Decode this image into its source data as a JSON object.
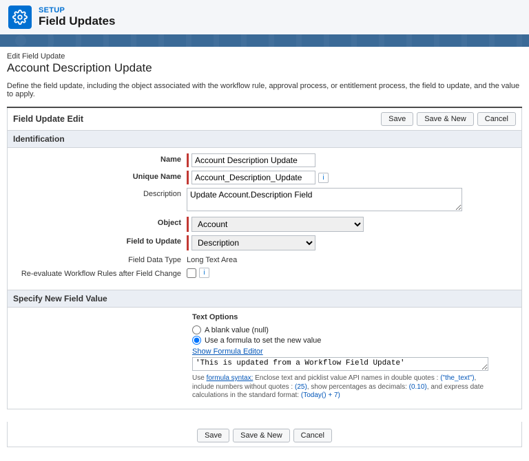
{
  "header": {
    "setup_label": "SETUP",
    "title": "Field Updates"
  },
  "page": {
    "edit_small": "Edit Field Update",
    "title": "Account Description Update",
    "intro": "Define the field update, including the object associated with the workflow rule, approval process, or entitlement process, the field to update, and the value to apply."
  },
  "panel": {
    "title": "Field Update Edit",
    "save": "Save",
    "save_new": "Save & New",
    "cancel": "Cancel"
  },
  "identification": {
    "section_title": "Identification",
    "name_label": "Name",
    "name_value": "Account Description Update",
    "unique_label": "Unique Name",
    "unique_value": "Account_Description_Update",
    "description_label": "Description",
    "description_value": "Update Account.Description Field",
    "object_label": "Object",
    "object_value": "Account",
    "field_label": "Field to Update",
    "field_value": "Description",
    "datatype_label": "Field Data Type",
    "datatype_value": "Long Text Area",
    "reeval_label": "Re-evaluate Workflow Rules after Field Change"
  },
  "newvalue": {
    "section_title": "Specify New Field Value",
    "text_options": "Text Options",
    "opt_blank": "A blank value (null)",
    "opt_formula": "Use a formula to set the new value",
    "show_editor": "Show Formula Editor",
    "formula_value": "'This is updated from a Workflow Field Update'",
    "hint_pre": "Use ",
    "hint_link": "formula syntax:",
    "hint_1": " Enclose text and picklist value API names in double quotes : ",
    "hint_ex1": "(\"the_text\")",
    "hint_2": ", include numbers without quotes : ",
    "hint_ex2": "(25)",
    "hint_3": ", show percentages as decimals: ",
    "hint_ex3": "(0.10)",
    "hint_4": ", and express date calculations in the standard format: ",
    "hint_ex4": "(Today() + 7)"
  }
}
